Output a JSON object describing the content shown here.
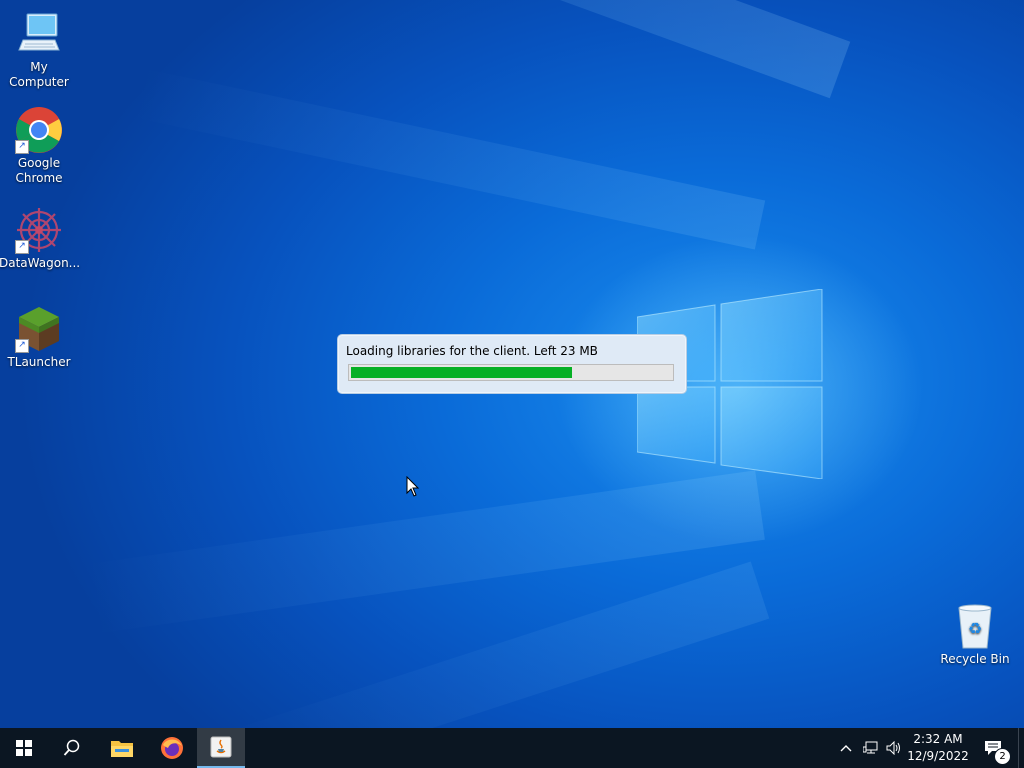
{
  "desktop": {
    "icons": [
      {
        "label": "My Computer"
      },
      {
        "label": "Google Chrome"
      },
      {
        "label": "DataWagon..."
      },
      {
        "label": "TLauncher"
      },
      {
        "label": "Recycle Bin"
      }
    ]
  },
  "loader": {
    "message": "Loading libraries for the client. Left 23 MB",
    "progress": 0.69,
    "bar_color": "#06b025"
  },
  "taskbar": {
    "apps": [
      "start-icon",
      "search-icon",
      "file-explorer-icon",
      "firefox-icon",
      "java-icon"
    ],
    "active_app": "java-icon",
    "clock": {
      "time": "2:32 AM",
      "date": "12/9/2022"
    },
    "notifications": "2"
  },
  "colors": {
    "desktop_bg": "#0a6bd8",
    "taskbar_bg": "#0b1622"
  }
}
